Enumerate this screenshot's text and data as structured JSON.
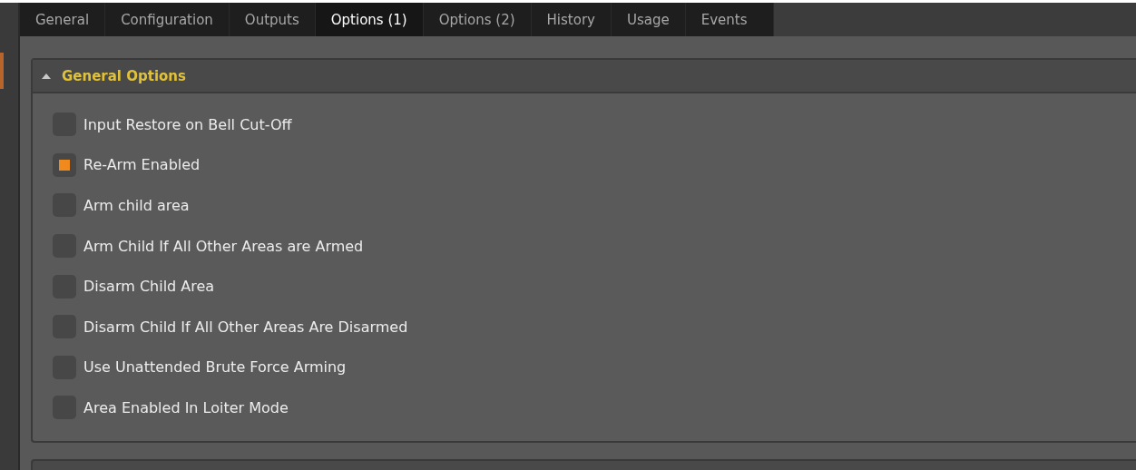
{
  "tabs": [
    {
      "label": "General",
      "selected": false
    },
    {
      "label": "Configuration",
      "selected": false
    },
    {
      "label": "Outputs",
      "selected": false
    },
    {
      "label": "Options (1)",
      "selected": true
    },
    {
      "label": "Options (2)",
      "selected": false
    },
    {
      "label": "History",
      "selected": false
    },
    {
      "label": "Usage",
      "selected": false
    },
    {
      "label": "Events",
      "selected": false
    }
  ],
  "section": {
    "title": "General Options",
    "expanded": true,
    "options": [
      {
        "label": "Input Restore on Bell Cut-Off",
        "checked": false
      },
      {
        "label": "Re-Arm Enabled",
        "checked": true
      },
      {
        "label": "Arm child area",
        "checked": false
      },
      {
        "label": "Arm Child If All Other Areas are Armed",
        "checked": false
      },
      {
        "label": "Disarm Child Area",
        "checked": false
      },
      {
        "label": "Disarm Child If All Other Areas Are Disarmed",
        "checked": false
      },
      {
        "label": "Use Unattended Brute Force Arming",
        "checked": false
      },
      {
        "label": "Area Enabled In Loiter Mode",
        "checked": false
      }
    ]
  }
}
